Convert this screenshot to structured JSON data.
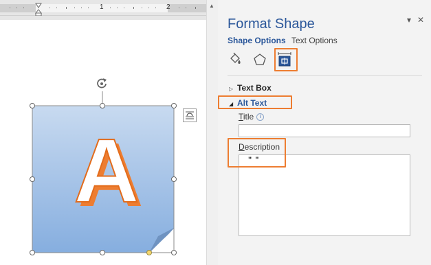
{
  "ruler": {
    "marks": [
      "1",
      "2"
    ]
  },
  "pane": {
    "title": "Format Shape",
    "pin_glyph": "▾",
    "close_glyph": "✕",
    "tabs": [
      {
        "label": "Shape Options",
        "active": true
      },
      {
        "label": "Text Options",
        "active": false
      }
    ],
    "category_icons": [
      "fill-line-icon",
      "effects-pentagon-icon",
      "layout-properties-icon"
    ],
    "sections": {
      "text_box": {
        "label": "Text Box",
        "expanded": false
      },
      "alt_text": {
        "label": "Alt Text",
        "expanded": true
      }
    },
    "fields": {
      "title": {
        "label_first": "T",
        "label_rest": "itle",
        "value": ""
      },
      "description": {
        "label_first": "D",
        "label_rest": "escription",
        "value": "\" \""
      }
    }
  },
  "shape": {
    "letter": "A"
  },
  "colors": {
    "accent_blue": "#2b579a",
    "highlight_orange": "#ed7d31",
    "shape_top": "#c8daf0",
    "shape_bottom": "#86aedf",
    "letter_shadow": "#ed7d31"
  }
}
